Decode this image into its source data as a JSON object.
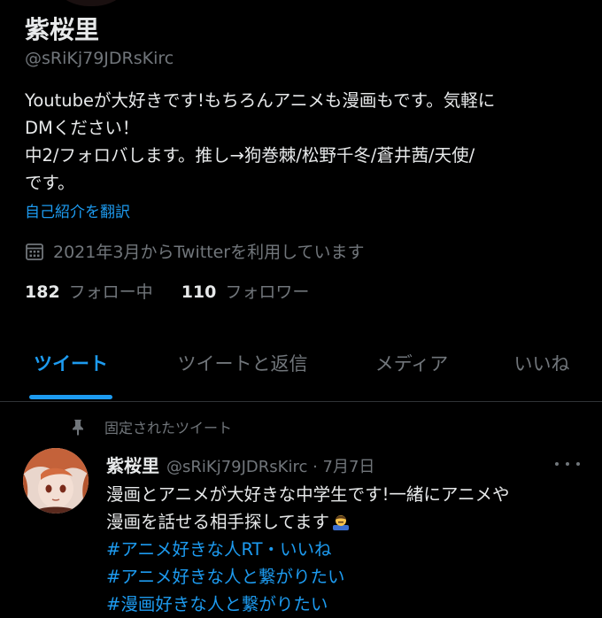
{
  "profile": {
    "display_name": "紫桜里",
    "handle": "@sRiKj79JDRsKirc",
    "bio_lines": [
      "Youtubeが大好きです!もちろんアニメも漫画もです。気軽に",
      "DMください！",
      "中2/フォロバします。推し→狗巻棘/松野千冬/蒼井茜/天使/",
      "です。"
    ],
    "translate_label": "自己紹介を翻訳",
    "joined_text": "2021年3月からTwitterを利用しています",
    "following_count": "182",
    "following_label": "フォロー中",
    "followers_count": "110",
    "followers_label": "フォロワー"
  },
  "tabs": [
    {
      "label": "ツイート",
      "active": true
    },
    {
      "label": "ツイートと返信",
      "active": false
    },
    {
      "label": "メディア",
      "active": false
    },
    {
      "label": "いいね",
      "active": false
    }
  ],
  "pinned_tweet": {
    "pinned_label": "固定されたツイート",
    "author_name": "紫桜里",
    "author_meta": "@sRiKj79JDRsKirc · 7月7日",
    "body_lines": [
      "漫画とアニメが大好きな中学生です!一緒にアニメや",
      "漫画を話せる相手探してます"
    ],
    "hashtags": [
      "#アニメ好きな人RT・いいね",
      "#アニメ好きな人と繋がりたい",
      "#漫画好きな人と繋がりたい"
    ]
  },
  "colors": {
    "background": "#000000",
    "text_primary": "#e7e9ea",
    "text_secondary": "#71767b",
    "accent": "#1d9bf0",
    "divider": "#2f3336"
  },
  "icons": {
    "calendar": "calendar-icon",
    "pin": "pin-icon",
    "more": "more-options-icon",
    "emoji": "person-bowing-emoji"
  }
}
